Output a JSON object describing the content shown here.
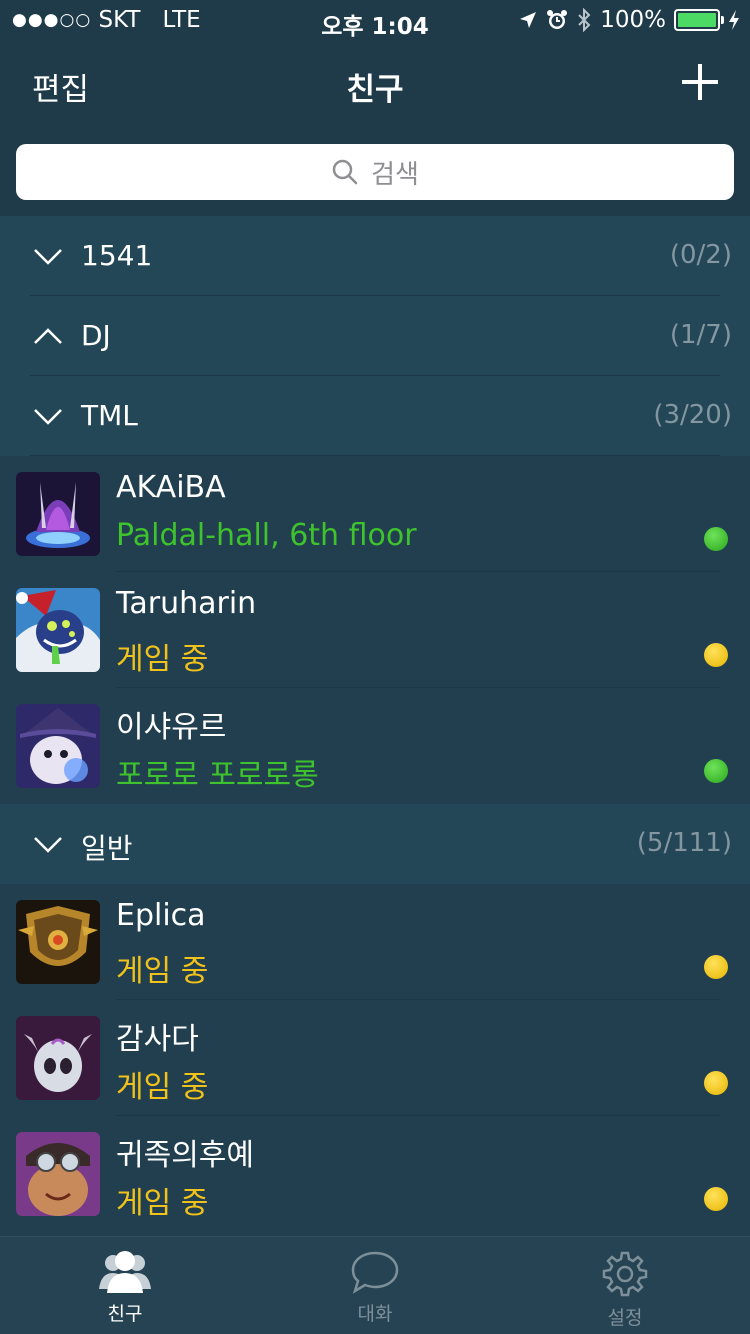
{
  "status_bar": {
    "signal_dots": "●●●○○",
    "carrier": "SKT",
    "network": "LTE",
    "time": "오후 1:04",
    "battery": "100%",
    "battery_level": 1.0,
    "icons": [
      "location-arrow-icon",
      "alarm-clock-icon",
      "bluetooth-icon",
      "battery-icon",
      "charging-bolt-icon"
    ]
  },
  "nav": {
    "edit_label": "편집",
    "title": "친구",
    "add_icon": "plus-icon"
  },
  "search": {
    "placeholder": "검색",
    "icon": "search-icon"
  },
  "groups": [
    {
      "name": "1541",
      "count": "(0/2)",
      "expanded": false
    },
    {
      "name": "DJ",
      "count": "(1/7)",
      "expanded": true
    },
    {
      "name": "TML",
      "count": "(3/20)",
      "expanded": false
    },
    {
      "name": "일반",
      "count": "(5/111)",
      "expanded": false
    }
  ],
  "tml_friends": [
    {
      "name": "AKAiBA",
      "status": "Paldal-hall, 6th floor",
      "state": "online",
      "status_color": "#3ec22d"
    },
    {
      "name": "Taruharin",
      "status": "게임 중",
      "state": "in-game",
      "status_color": "#f0c21a"
    },
    {
      "name": "이샤유르",
      "status": "포로로 포로로롱",
      "state": "online",
      "status_color": "#3ec22d"
    }
  ],
  "general_friends": [
    {
      "name": "Eplica",
      "status": "게임 중",
      "state": "in-game",
      "status_color": "#f0c21a"
    },
    {
      "name": "감사다",
      "status": "게임 중",
      "state": "in-game",
      "status_color": "#f0c21a"
    },
    {
      "name": "귀족의후예",
      "status": "게임 중",
      "state": "in-game",
      "status_color": "#f0c21a"
    }
  ],
  "tabs": [
    {
      "label": "친구",
      "icon": "friends-icon",
      "active": true
    },
    {
      "label": "대화",
      "icon": "chat-bubble-icon",
      "active": false
    },
    {
      "label": "설정",
      "icon": "gear-icon",
      "active": false
    }
  ],
  "colors": {
    "background": "#213f4f",
    "group_header": "#234757",
    "online": "#3ec22d",
    "in_game": "#f0c21a"
  }
}
